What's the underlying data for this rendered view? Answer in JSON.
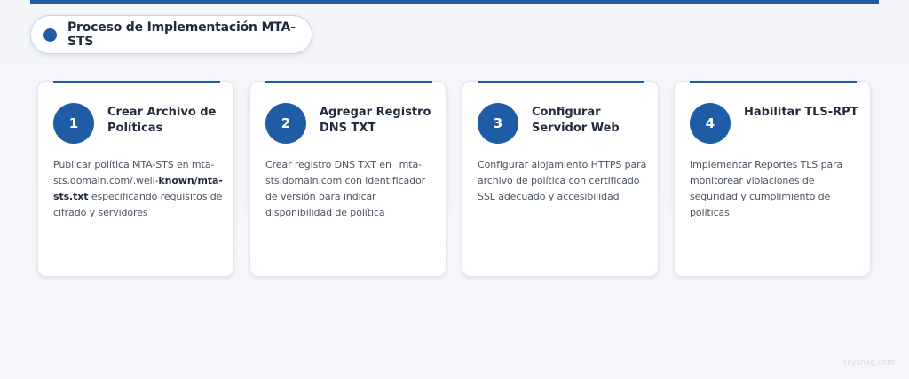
{
  "section": {
    "title": "Proceso de Implementación MTA-STS"
  },
  "steps": [
    {
      "number": "1",
      "title": "Crear Archivo de Políticas",
      "desc_a": "Publicar política MTA-STS en mta-sts.domain.com/.well-",
      "desc_b": "known/mta-sts.txt",
      "desc_c": " especificando requisitos de cifrado y servidores"
    },
    {
      "number": "2",
      "title": "Agregar Registro DNS TXT",
      "desc": "Crear registro DNS TXT en _mta-sts.domain.com con identificador de versión para indicar disponibilidad de política"
    },
    {
      "number": "3",
      "title": "Configurar Servidor Web",
      "desc": "Configurar alojamiento HTTPS para archivo de política con certificado SSL adecuado y accesibilidad"
    },
    {
      "number": "4",
      "title": "Habilitar TLS-RPT",
      "desc": "Implementar Reportes TLS para monitorear violaciones de seguridad y cumplimiento de políticas"
    }
  ],
  "watermark": "skysnag.com",
  "colors": {
    "accent": "#1f5ca6",
    "text": "#1f2a3a",
    "muted": "#4a5565"
  }
}
